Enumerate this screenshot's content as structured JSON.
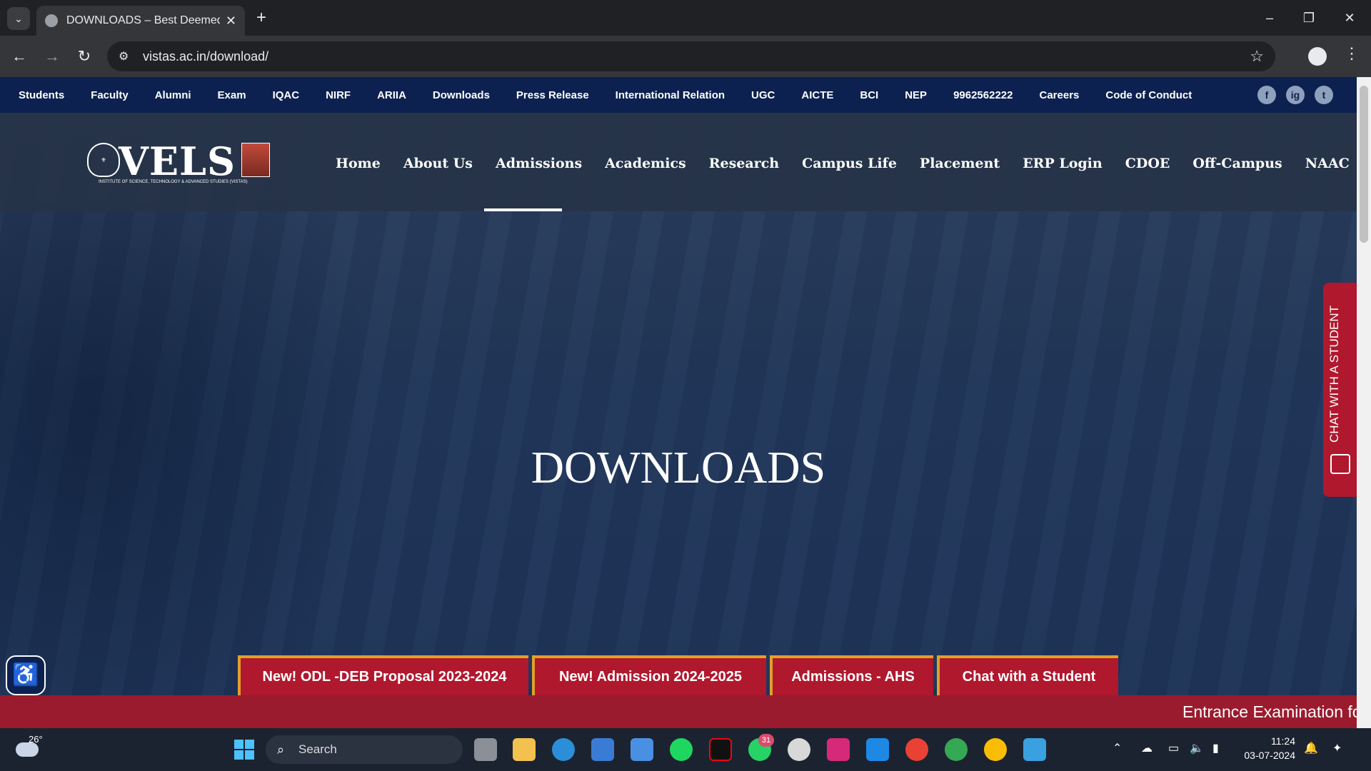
{
  "browser": {
    "tab_title": "DOWNLOADS – Best Deemed U",
    "url": "vistas.ac.in/download/"
  },
  "topnav": {
    "items": [
      "Students",
      "Faculty",
      "Alumni",
      "Exam",
      "IQAC",
      "NIRF",
      "ARIIA",
      "Downloads",
      "Press Release",
      "International Relation",
      "UGC",
      "AICTE",
      "BCI",
      "NEP",
      "9962562222",
      "Careers",
      "Code of Conduct"
    ],
    "social": [
      "f",
      "ig",
      "t"
    ]
  },
  "logo": {
    "text": "VELS",
    "subtitle": "INSTITUTE OF SCIENCE, TECHNOLOGY & ADVANCED STUDIES (VISTAS)"
  },
  "mainnav": {
    "items": [
      "Home",
      "About Us",
      "Admissions",
      "Academics",
      "Research",
      "Campus Life",
      "Placement",
      "ERP Login",
      "CDOE",
      "Off-Campus",
      "NAAC"
    ],
    "active": "Admissions"
  },
  "hero": {
    "heading": "DOWNLOADS"
  },
  "chat_side": {
    "label": "CHAT WITH A STUDENT"
  },
  "promos": [
    "New! ODL -DEB Proposal 2023-2024",
    "New! Admission 2024-2025",
    "Admissions - AHS",
    "Chat with a Student"
  ],
  "ticker": {
    "text": "Entrance Examination fo"
  },
  "taskbar": {
    "temperature": "26°",
    "search_placeholder": "Search",
    "whatsapp_badge": "31",
    "time": "11:24",
    "date": "03-07-2024"
  },
  "colors": {
    "topnav_bg": "#0c2150",
    "accent_red": "#b0182e",
    "accent_gold": "#e0a02a"
  }
}
